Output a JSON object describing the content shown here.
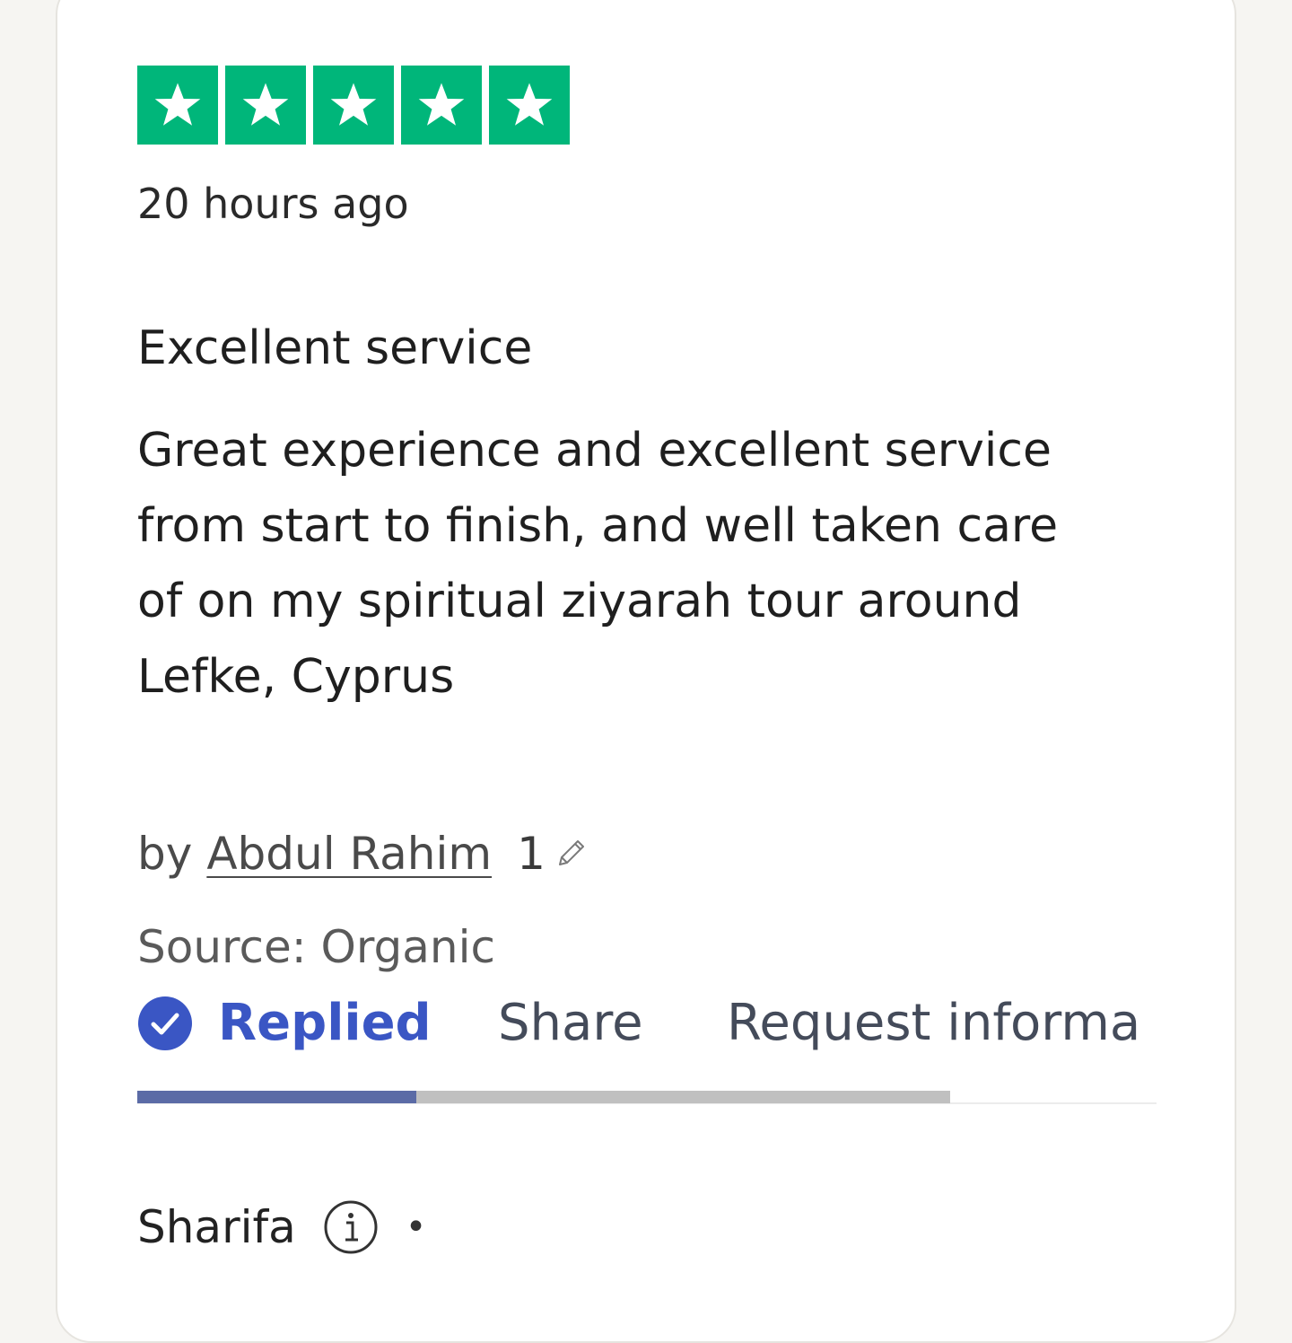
{
  "review": {
    "rating": 5,
    "rating_max": 5,
    "star_color": "#00b67a",
    "time_ago": "20 hours ago",
    "title": "Excellent service",
    "body_lines": [
      "Great experience and excellent service",
      "from start to finish, and well taken care",
      "of on my spiritual ziyarah tour around",
      "Lefke, Cyprus"
    ],
    "author_prefix": "by",
    "author_name": "Abdul Rahim",
    "author_review_count": "1",
    "source": "Source: Organic"
  },
  "actions": {
    "replied_label": "Replied",
    "share_label": "Share",
    "request_label": "Request informa",
    "replied_color": "#3a56c4"
  },
  "tab_indicator": {
    "active_fraction": 0.343
  },
  "reply": {
    "replier_name": "Sharifa",
    "separator": "•"
  },
  "icons": {
    "star": "star-icon",
    "pencil": "pencil-icon",
    "check": "check-circle-icon",
    "info": "info-icon"
  }
}
